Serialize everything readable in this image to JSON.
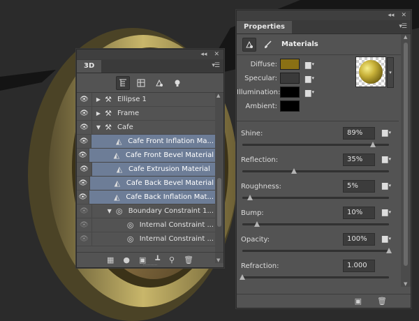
{
  "panel_3d": {
    "tab": "3D",
    "menu_icon": "panel-menu-icon",
    "filters": [
      "whole-scene-icon",
      "meshes-icon",
      "materials-icon",
      "lights-icon"
    ],
    "layers": [
      {
        "name": "Ellipse 1",
        "expanded": false,
        "icon": "mesh-icon",
        "selected": false,
        "visible": true
      },
      {
        "name": "Frame",
        "expanded": false,
        "icon": "mesh-icon",
        "selected": false,
        "visible": true
      },
      {
        "name": "Cafe",
        "expanded": true,
        "icon": "mesh-icon",
        "selected": false,
        "visible": true
      },
      {
        "name": "Cafe Front Inflation Ma...",
        "icon": "material-icon",
        "selected": true,
        "visible": true
      },
      {
        "name": "Cafe Front Bevel Material",
        "icon": "material-icon",
        "selected": true,
        "visible": true
      },
      {
        "name": "Cafe Extrusion Material",
        "icon": "material-icon",
        "selected": true,
        "visible": true
      },
      {
        "name": "Cafe Back Bevel Material",
        "icon": "material-icon",
        "selected": true,
        "visible": true
      },
      {
        "name": "Cafe Back Inflation Mat...",
        "icon": "material-icon",
        "selected": true,
        "visible": true
      },
      {
        "name": "Boundary Constraint 1...",
        "expanded": true,
        "icon": "constraint-icon",
        "selected": false,
        "visible": false
      },
      {
        "name": "Internal Constraint ...",
        "icon": "constraint-icon",
        "selected": false,
        "visible": false
      },
      {
        "name": "Internal Constraint ...",
        "icon": "constraint-icon",
        "selected": false,
        "visible": false
      }
    ],
    "bottom_icons": [
      "render-icon",
      "light-bulb-icon",
      "new-mesh-icon",
      "new-light-icon",
      "constraint-add-icon",
      "trash-icon"
    ]
  },
  "properties": {
    "tab": "Properties",
    "section_title": "Materials",
    "colors": {
      "diffuse": "#8a7014",
      "specular": "#3a3a3a",
      "illumination": "#000000",
      "ambient": "#000000"
    },
    "color_labels": {
      "diffuse": "Diffuse:",
      "specular": "Specular:",
      "illumination": "Illumination:",
      "ambient": "Ambient:"
    },
    "sliders": [
      {
        "label": "Shine:",
        "value": "89%",
        "level": 0.89
      },
      {
        "label": "Reflection:",
        "value": "35%",
        "level": 0.35
      },
      {
        "label": "Roughness:",
        "value": "5%",
        "level": 0.05
      },
      {
        "label": "Bump:",
        "value": "10%",
        "level": 0.1
      },
      {
        "label": "Opacity:",
        "value": "100%",
        "level": 1.0
      },
      {
        "label": "Refraction:",
        "value": "1.000",
        "level": 0.0
      }
    ]
  }
}
